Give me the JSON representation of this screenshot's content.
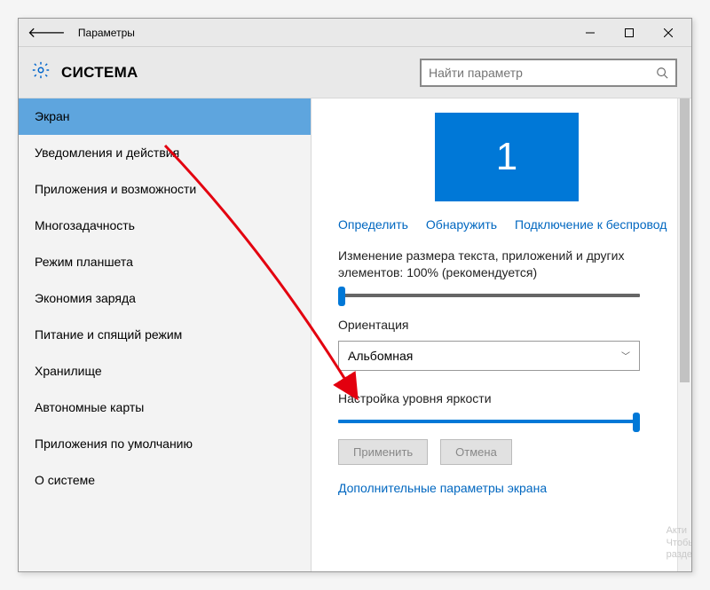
{
  "window": {
    "title": "Параметры",
    "section": "СИСТЕМА"
  },
  "search": {
    "placeholder": "Найти параметр"
  },
  "sidebar": {
    "items": [
      {
        "label": "Экран"
      },
      {
        "label": "Уведомления и действия"
      },
      {
        "label": "Приложения и возможности"
      },
      {
        "label": "Многозадачность"
      },
      {
        "label": "Режим планшета"
      },
      {
        "label": "Экономия заряда"
      },
      {
        "label": "Питание и спящий режим"
      },
      {
        "label": "Хранилище"
      },
      {
        "label": "Автономные карты"
      },
      {
        "label": "Приложения по умолчанию"
      },
      {
        "label": "О системе"
      }
    ],
    "selected_index": 0
  },
  "display": {
    "monitor_number": "1",
    "links": {
      "identify": "Определить",
      "detect": "Обнаружить",
      "wireless": "Подключение к беспровод"
    },
    "scale_label": "Изменение размера текста, приложений и других элементов: 100% (рекомендуется)",
    "orientation_label": "Ориентация",
    "orientation_value": "Альбомная",
    "brightness_label": "Настройка уровня яркости",
    "apply": "Применить",
    "cancel": "Отмена",
    "advanced": "Дополнительные параметры экрана"
  },
  "watermark": {
    "line1": "Акти",
    "line2": "Чтобь",
    "line3": "разде"
  },
  "colors": {
    "accent": "#0078d7",
    "link": "#0067c0"
  }
}
